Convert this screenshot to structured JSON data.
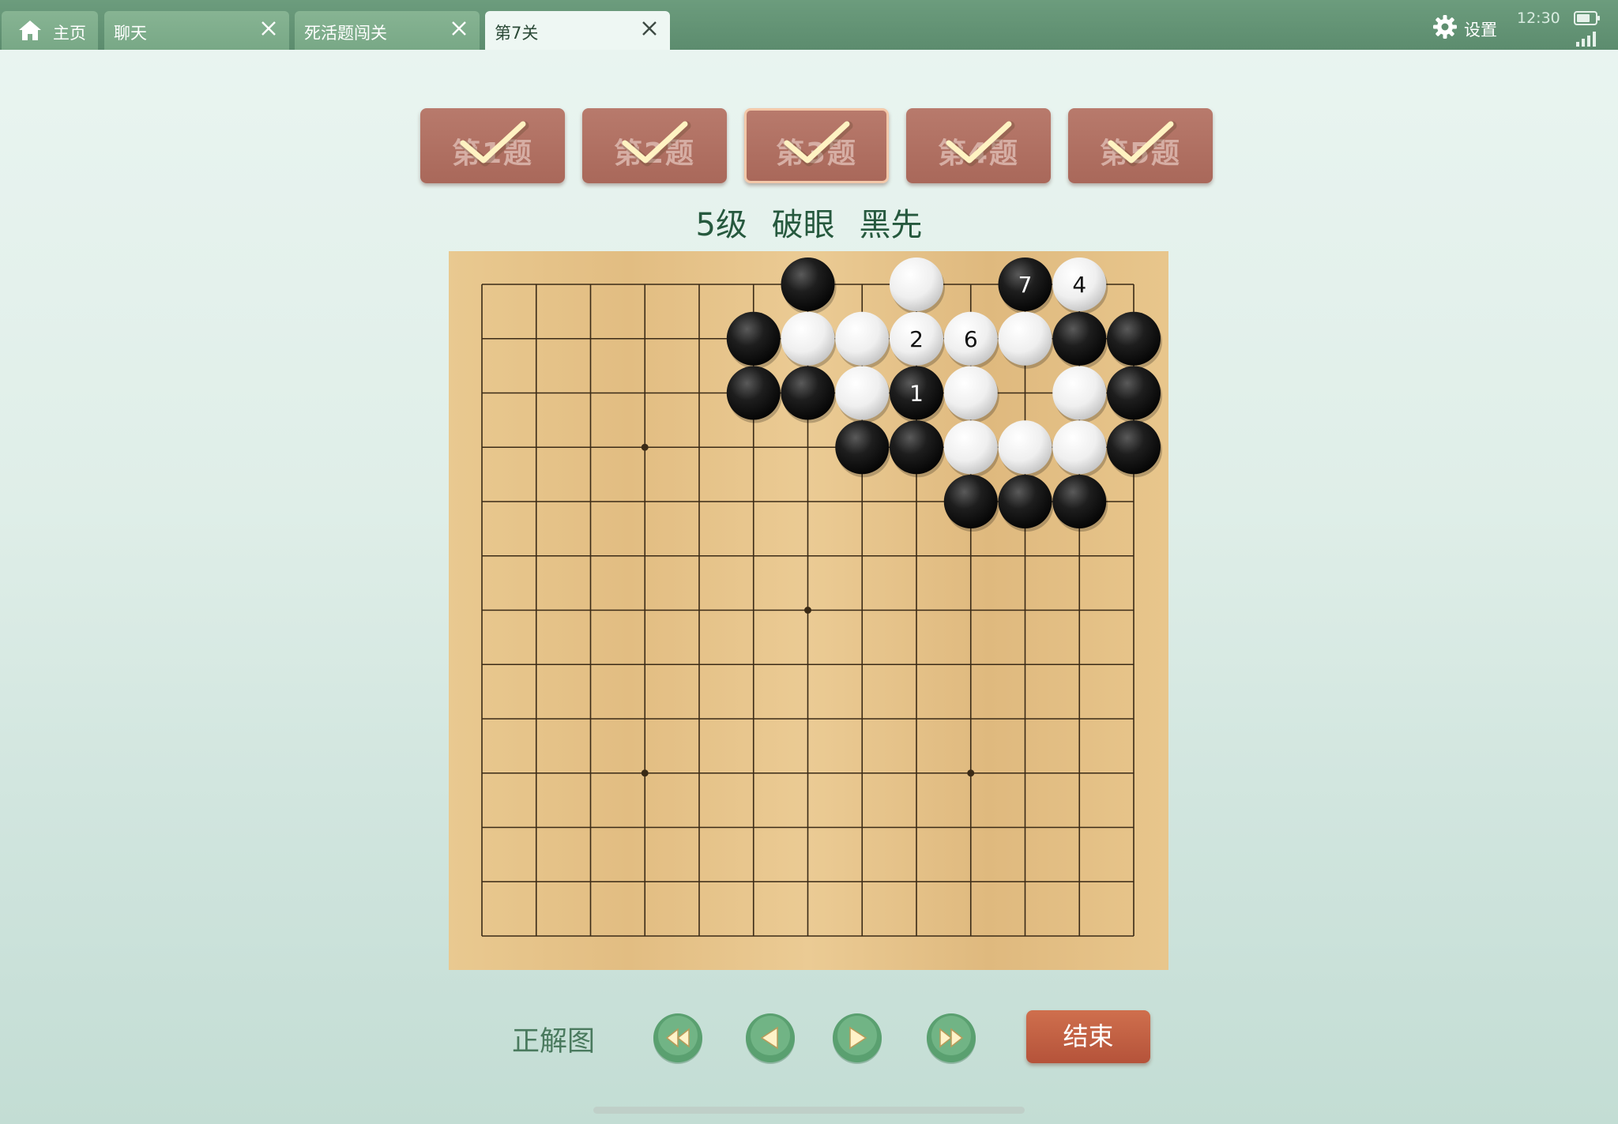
{
  "tabs": [
    {
      "label": "主页",
      "icon": "home-icon",
      "active": false
    },
    {
      "label": "聊天",
      "closable": true,
      "active": false
    },
    {
      "label": "死活题闯关",
      "closable": true,
      "active": false
    },
    {
      "label": "第7关",
      "closable": true,
      "active": true
    }
  ],
  "status": {
    "settings_label": "设置",
    "time": "12:30"
  },
  "problems": [
    {
      "label": "第1题",
      "solved": true
    },
    {
      "label": "第2题",
      "solved": true
    },
    {
      "label": "第3题",
      "solved": true,
      "current": true
    },
    {
      "label": "第4题",
      "solved": true
    },
    {
      "label": "第5题",
      "solved": true
    }
  ],
  "subtitle": {
    "level": "5级",
    "topic": "破眼",
    "to_play": "黑先"
  },
  "board": {
    "size": 13,
    "stones": [
      {
        "color": "black",
        "col": 6,
        "row": 0
      },
      {
        "color": "white",
        "col": 8,
        "row": 0
      },
      {
        "color": "black",
        "col": 10,
        "row": 0,
        "label": "7"
      },
      {
        "color": "white",
        "col": 11,
        "row": 0,
        "label": "4"
      },
      {
        "color": "black",
        "col": 5,
        "row": 1
      },
      {
        "color": "white",
        "col": 6,
        "row": 1
      },
      {
        "color": "white",
        "col": 7,
        "row": 1
      },
      {
        "color": "white",
        "col": 8,
        "row": 1,
        "label": "2"
      },
      {
        "color": "white",
        "col": 9,
        "row": 1,
        "label": "6"
      },
      {
        "color": "white",
        "col": 10,
        "row": 1
      },
      {
        "color": "black",
        "col": 11,
        "row": 1
      },
      {
        "color": "black",
        "col": 12,
        "row": 1
      },
      {
        "color": "black",
        "col": 5,
        "row": 2
      },
      {
        "color": "black",
        "col": 6,
        "row": 2
      },
      {
        "color": "white",
        "col": 7,
        "row": 2
      },
      {
        "color": "black",
        "col": 8,
        "row": 2,
        "label": "1"
      },
      {
        "color": "white",
        "col": 9,
        "row": 2
      },
      {
        "color": "white",
        "col": 11,
        "row": 2
      },
      {
        "color": "black",
        "col": 12,
        "row": 2
      },
      {
        "color": "black",
        "col": 7,
        "row": 3
      },
      {
        "color": "black",
        "col": 8,
        "row": 3
      },
      {
        "color": "white",
        "col": 9,
        "row": 3
      },
      {
        "color": "white",
        "col": 10,
        "row": 3
      },
      {
        "color": "white",
        "col": 11,
        "row": 3
      },
      {
        "color": "black",
        "col": 12,
        "row": 3
      },
      {
        "color": "black",
        "col": 9,
        "row": 4
      },
      {
        "color": "black",
        "col": 10,
        "row": 4
      },
      {
        "color": "black",
        "col": 11,
        "row": 4
      }
    ]
  },
  "controls": {
    "answer_label": "正解图",
    "buttons": [
      "first-move",
      "previous-move",
      "next-move",
      "last-move"
    ],
    "end_label": "结束"
  },
  "colors": {
    "topbar": "#5c8c6e",
    "tab": "#78a886",
    "problem_button": "#a9685a",
    "end_button": "#b5533a",
    "nav_button": "#5aa070",
    "board_wood": "#e6c48d"
  }
}
